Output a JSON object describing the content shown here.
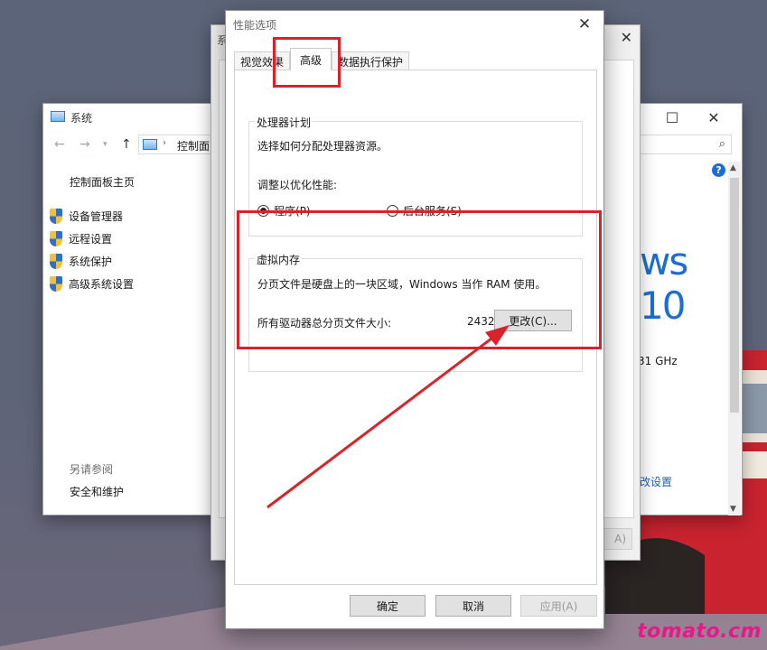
{
  "system_window": {
    "title": "系统",
    "breadcrumb": "控制面",
    "sidebar_home": "控制面板主页",
    "sidebar_links": [
      "设备管理器",
      "远程设置",
      "系统保护",
      "高级系统设置"
    ],
    "see_also_heading": "另请参阅",
    "see_also_link": "安全和维护",
    "brand_text": "ws 10",
    "cpu_speed_partial": "31 GHz",
    "change_settings_partial": "改设置"
  },
  "system_properties": {
    "title_partial": "系",
    "apply_partial": "A)"
  },
  "perf_dialog": {
    "title": "性能选项",
    "tabs": [
      "视觉效果",
      "高级",
      "数据执行保护"
    ],
    "active_tab": "高级",
    "processor": {
      "legend": "处理器计划",
      "desc": "选择如何分配处理器资源。",
      "optimize_label": "调整以优化性能:",
      "radio_programs": "程序(P)",
      "radio_services": "后台服务(S)",
      "selected": "programs"
    },
    "virtual_memory": {
      "legend": "虚拟内存",
      "desc": "分页文件是硬盘上的一块区域，Windows 当作 RAM 使用。",
      "total_label": "所有驱动器总分页文件大小:",
      "total_value": "2432 MB",
      "change_button": "更改(C)..."
    },
    "buttons": {
      "ok": "确定",
      "cancel": "取消",
      "apply": "应用(A)"
    }
  },
  "watermark": "tomato.cm",
  "colors": {
    "highlight": "#d9232b",
    "watermark": "#e8178a",
    "link": "#1f64b0"
  }
}
